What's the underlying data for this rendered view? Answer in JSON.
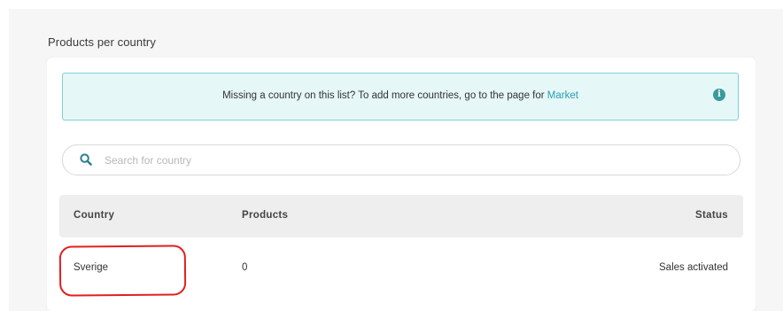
{
  "section": {
    "title": "Products per country"
  },
  "info_banner": {
    "text": "Missing a country on this list? To add more countries, go to the page for ",
    "link_label": "Market",
    "icon": "info-icon"
  },
  "search": {
    "placeholder": "Search for country",
    "value": "",
    "icon": "search-icon"
  },
  "table": {
    "columns": [
      "Country",
      "Products",
      "Status"
    ],
    "rows": [
      {
        "country": "Sverige",
        "products": "0",
        "status": "Sales activated"
      }
    ]
  },
  "colors": {
    "accent": "#2a9fb0",
    "info_bg": "#e6f7f7",
    "info_border": "#7fd0d0",
    "annotation": "#e02020"
  }
}
